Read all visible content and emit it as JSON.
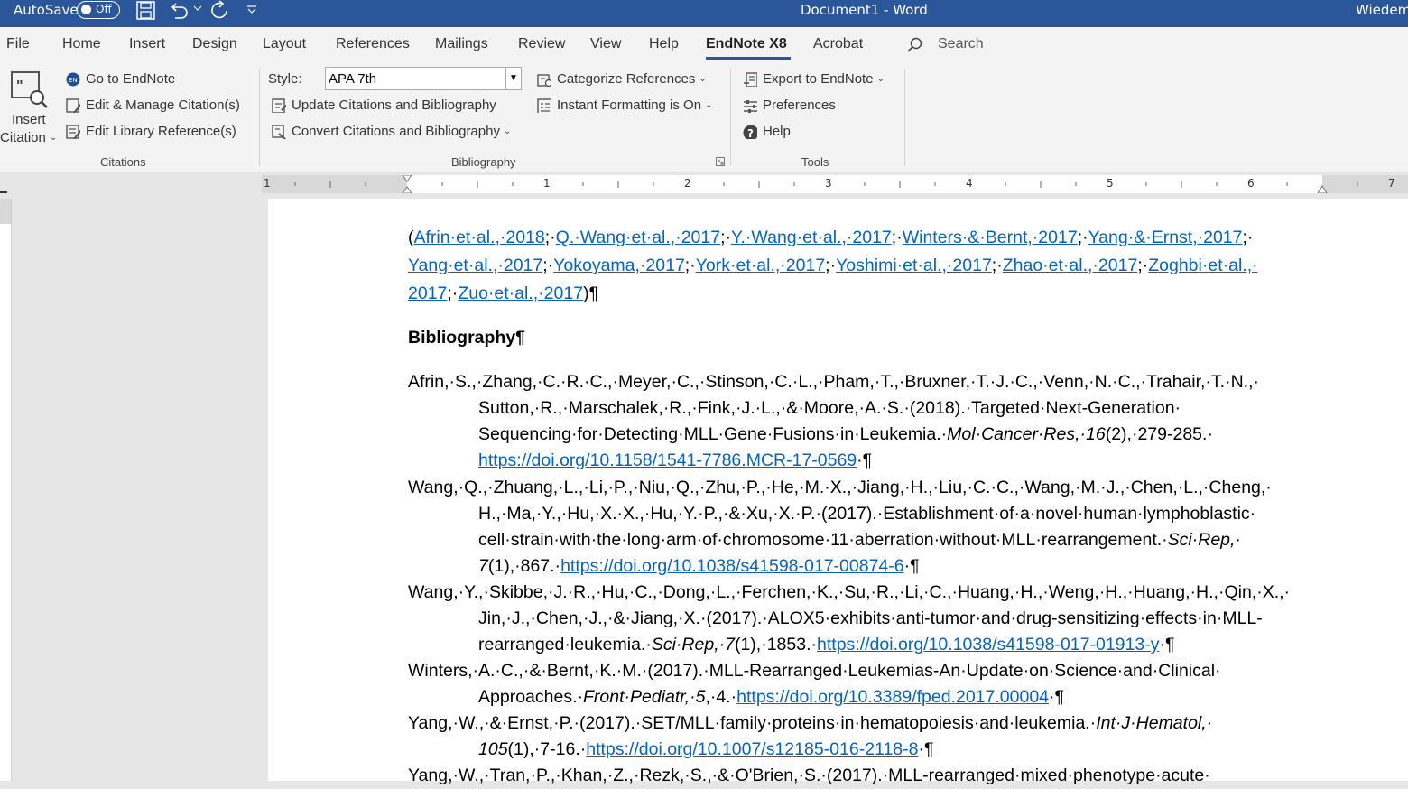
{
  "titlebar": {
    "autosave_label": "AutoSave",
    "autosave_state": "Off",
    "document_title": "Document1  -  Word",
    "user": "Wiedem"
  },
  "tabs": [
    "File",
    "Home",
    "Insert",
    "Design",
    "Layout",
    "References",
    "Mailings",
    "Review",
    "View",
    "Help",
    "EndNote X8",
    "Acrobat"
  ],
  "search_label": "Search",
  "ribbon": {
    "insert_citation_line1": "Insert",
    "insert_citation_line2": "Citation",
    "go_to_endnote": "Go to EndNote",
    "edit_manage_citations": "Edit & Manage Citation(s)",
    "edit_library_references": "Edit Library Reference(s)",
    "citations_group": "Citations",
    "style_label": "Style:",
    "style_value": "APA 7th",
    "update_citations": "Update Citations and Bibliography",
    "convert_citations": "Convert Citations and Bibliography",
    "categorize_references": "Categorize References",
    "instant_formatting": "Instant Formatting is On",
    "bibliography_group": "Bibliography",
    "export_to_endnote": "Export to EndNote",
    "preferences": "Preferences",
    "help": "Help",
    "tools_group": "Tools"
  },
  "ruler_numbers": [
    "1",
    "1",
    "2",
    "3",
    "4",
    "5",
    "6",
    "7"
  ],
  "document": {
    "citations": [
      {
        "text": "Afrin·et·al.,·2018",
        "sep": ";·"
      },
      {
        "text": "Q.·Wang·et·al.,·2017",
        "sep": ";·"
      },
      {
        "text": "Y.·Wang·et·al.,·2017",
        "sep": ";·"
      },
      {
        "text": "Winters·&·Bernt,·2017",
        "sep": ";·"
      },
      {
        "text": "Yang·&·Ernst,·2017",
        "sep": ";·"
      },
      {
        "text": "Yang·et·al.,·2017",
        "sep": ";·"
      },
      {
        "text": "Yokoyama,·2017",
        "sep": ";·"
      },
      {
        "text": "York·et·al.,·2017",
        "sep": ";·"
      },
      {
        "text": "Yoshimi·et·al.,·2017",
        "sep": ";·"
      },
      {
        "text": "Zhao·et·al.,·2017",
        "sep": ";·"
      },
      {
        "text": "Zoghbi·et·al.,·",
        "sep": ""
      },
      {
        "text": "2017",
        "sep": ";·"
      },
      {
        "text": "Zuo·et·al.,·2017",
        "sep": ""
      }
    ],
    "bibliography_heading": "Bibliography¶",
    "pilcrow": "¶",
    "references": [
      {
        "lines": [
          "Afrin,·S.,·Zhang,·C.·R.·C.,·Meyer,·C.,·Stinson,·C.·L.,·Pham,·T.,·Bruxner,·T.·J.·C.,·Venn,·N.·C.,·Trahair,·T.·N.,·",
          "Sutton,·R.,·Marschalek,·R.,·Fink,·J.·L.,·&·Moore,·A.·S.·(2018).·Targeted·Next-Generation·"
        ],
        "line3_plain": "Sequencing·for·Detecting·MLL·Gene·Fusions·in·Leukemia.·",
        "line3_italic": "Mol·Cancer·Res,·16",
        "line3_tail": "(2),·279-285.·",
        "link": "https://doi.org/10.1158/1541-7786.MCR-17-0569"
      },
      {
        "lines": [
          "Wang,·Q.,·Zhuang,·L.,·Li,·P.,·Niu,·Q.,·Zhu,·P.,·He,·M.·X.,·Jiang,·H.,·Liu,·C.·C.,·Wang,·M.·J.,·Chen,·L.,·Cheng,·",
          "H.,·Ma,·Y.,·Hu,·X.·X.,·Hu,·Y.·P.,·&·Xu,·X.·P.·(2017).·Establishment·of·a·novel·human·lymphoblastic·"
        ],
        "line3_plain": "cell·strain·with·the·long·arm·of·chromosome·11·aberration·without·MLL·rearrangement.·",
        "line3_italic": "Sci·Rep,·",
        "line4_italic": "7",
        "line4_plain": "(1),·867.·",
        "link": "https://doi.org/10.1038/s41598-017-00874-6"
      },
      {
        "lines": [
          "Wang,·Y.,·Skibbe,·J.·R.,·Hu,·C.,·Dong,·L.,·Ferchen,·K.,·Su,·R.,·Li,·C.,·Huang,·H.,·Weng,·H.,·Huang,·H.,·Qin,·X.,·",
          "Jin,·J.,·Chen,·J.,·&·Jiang,·X.·(2017).·ALOX5·exhibits·anti-tumor·and·drug-sensitizing·effects·in·MLL-"
        ],
        "line3_plain": "rearranged·leukemia.·",
        "line3_italic": "Sci·Rep,·7",
        "line3_tail": "(1),·1853.·",
        "link": "https://doi.org/10.1038/s41598-017-01913-y"
      },
      {
        "line1": "Winters,·A.·C.,·&·Bernt,·K.·M.·(2017).·MLL-Rearranged·Leukemias-An·Update·on·Science·and·Clinical·",
        "line2_plain": "Approaches.·",
        "line2_italic": "Front·Pediatr,·5",
        "line2_tail": ",·4.·",
        "link": "https://doi.org/10.3389/fped.2017.00004"
      },
      {
        "line1_plain": "Yang,·W.,·&·Ernst,·P.·(2017).·SET/MLL·family·proteins·in·hematopoiesis·and·leukemia.·",
        "line1_italic": "Int·J·Hematol,·",
        "line2_italic": "105",
        "line2_plain": "(1),·7-16.·",
        "link": "https://doi.org/10.1007/s12185-016-2118-8"
      },
      {
        "line1": "Yang,·W.,·Tran,·P.,·Khan,·Z.,·Rezk,·S.,·&·O'Brien,·S.·(2017).·MLL-rearranged·mixed·phenotype·acute·"
      }
    ]
  },
  "colors": {
    "title_bar": "#2b579a",
    "link": "#0563c1",
    "ribbon": "#f3f3f3"
  }
}
